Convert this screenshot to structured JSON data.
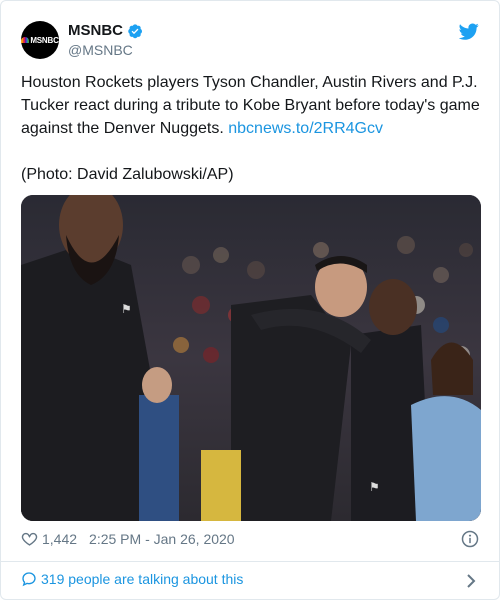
{
  "account": {
    "avatar_text": "MSNBC",
    "display_name": "MSNBC",
    "handle": "@MSNBC"
  },
  "tweet": {
    "text": "Houston Rockets players Tyson Chandler, Austin Rivers and P.J. Tucker react during a tribute to Kobe Bryant before today's game against the Denver Nuggets.",
    "link": "nbcnews.to/2RR4Gcv",
    "caption": "(Photo: David Zalubowski/AP)"
  },
  "meta": {
    "likes": "1,442",
    "timestamp": "2:25 PM - Jan 26, 2020"
  },
  "footer": {
    "talking": "319 people are talking about this"
  },
  "colors": {
    "link": "#1b95e0",
    "verified": "#1da1f2",
    "muted": "#657786"
  }
}
